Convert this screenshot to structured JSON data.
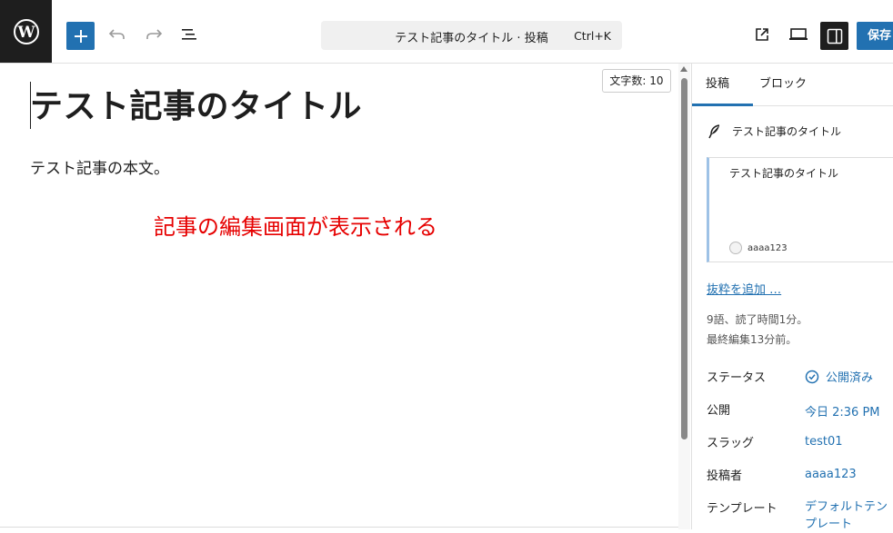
{
  "toolbar": {
    "document_title": "テスト記事のタイトル · 投稿",
    "shortcut": "Ctrl+K",
    "save_label": "保存"
  },
  "editor": {
    "title": "テスト記事のタイトル",
    "body": "テスト記事の本文。",
    "annotation": "記事の編集画面が表示される",
    "word_count": "文字数: 10"
  },
  "sidebar": {
    "tabs": [
      "投稿",
      "ブロック"
    ],
    "post_title": "テスト記事のタイトル",
    "preview": {
      "title": "テスト記事のタイトル",
      "author": "aaaa123"
    },
    "excerpt_link": "抜粋を追加 …",
    "meta": {
      "reading": "9語、読了時間1分。",
      "edited": "最終編集13分前。"
    },
    "rows": [
      {
        "label": "ステータス",
        "value": "公開済み"
      },
      {
        "label": "公開",
        "value": "今日 2:36 PM"
      },
      {
        "label": "スラッグ",
        "value": "test01"
      },
      {
        "label": "投稿者",
        "value": "aaaa123"
      },
      {
        "label": "テンプレート",
        "value": "デフォルトテンプレート"
      }
    ]
  },
  "colors": {
    "accent": "#2271b1",
    "annotation": "#e60000"
  }
}
